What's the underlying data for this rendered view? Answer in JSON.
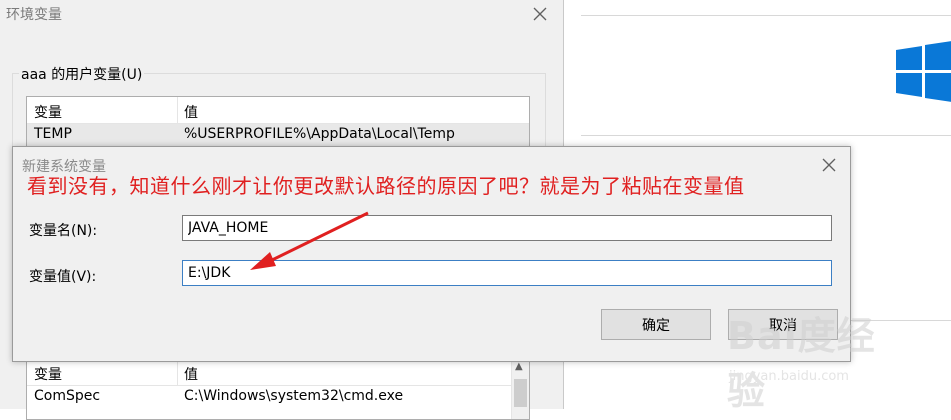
{
  "env_window": {
    "title": "环境变量",
    "user_group_label": "aaa 的用户变量(U)",
    "list_headers": {
      "variable": "变量",
      "value": "值"
    },
    "user_rows": [
      {
        "variable": "TEMP",
        "value": "%USERPROFILE%\\AppData\\Local\\Temp"
      }
    ],
    "system_rows": [
      {
        "variable": "ComSpec",
        "value": "C:\\Windows\\system32\\cmd.exe"
      }
    ]
  },
  "dialog": {
    "title": "新建系统变量",
    "name_label": "变量名(N):",
    "name_value": "JAVA_HOME",
    "value_label": "变量值(V):",
    "value_value": "E:\\JDK",
    "ok_label": "确定",
    "cancel_label": "取消"
  },
  "annotation": {
    "text": "看到没有，知道什么刚才让你更改默认路径的原因了吧？就是为了粘贴在变量值",
    "color": "#e02020"
  },
  "watermark": {
    "brand": "Bai度经验",
    "url": "jingyan.baidu.com"
  },
  "colors": {
    "windows_blue": "#0a78d7",
    "dialog_bg": "#f0f0f0",
    "focus_border": "#3c7fc4"
  },
  "icons": {
    "close": "close-icon",
    "logo": "windows-logo-icon",
    "arrow": "red-arrow-annotation"
  }
}
